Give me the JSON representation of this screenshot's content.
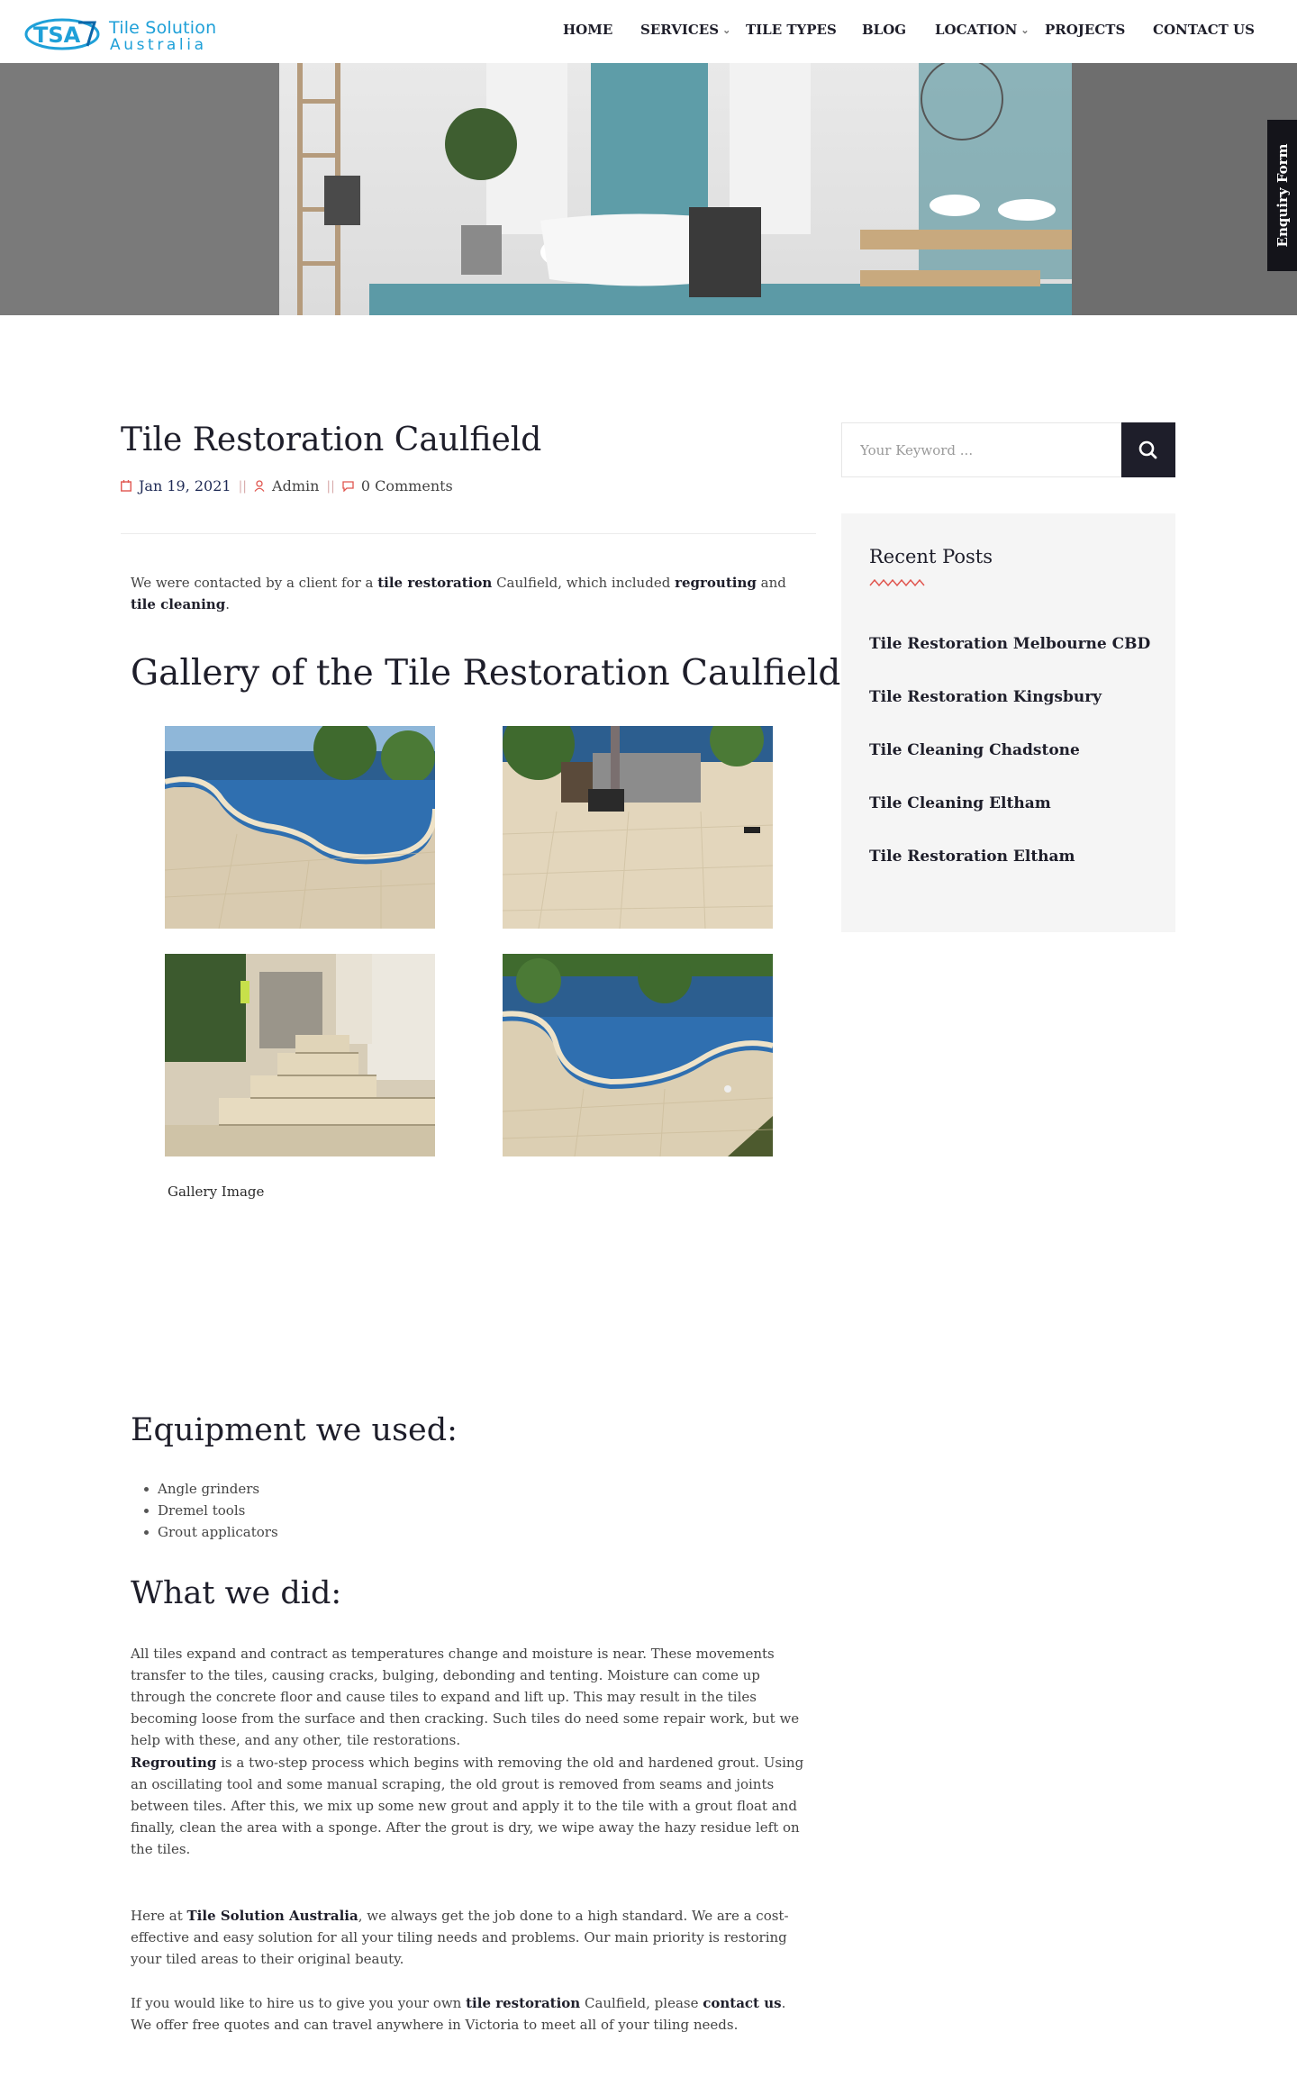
{
  "brand": {
    "name_line1": "Tile Solution",
    "name_line2": "Australia",
    "color": "#1fa0d8"
  },
  "nav": {
    "items": [
      {
        "label": "HOME",
        "has_dropdown": false
      },
      {
        "label": "SERVICES",
        "has_dropdown": true
      },
      {
        "label": "TILE TYPES",
        "has_dropdown": false
      },
      {
        "label": "BLOG",
        "has_dropdown": false
      },
      {
        "label": "LOCATION",
        "has_dropdown": true
      },
      {
        "label": "PROJECTS",
        "has_dropdown": false
      },
      {
        "label": "CONTACT US",
        "has_dropdown": false
      }
    ]
  },
  "enquiry_tab": {
    "label": "Enquiry Form"
  },
  "post": {
    "title": "Tile Restoration Caulfield",
    "date": "Jan 19, 2021",
    "author": "Admin",
    "comments": "0 Comments",
    "intro": {
      "p1": "We were contacted by a client for a ",
      "b1": "tile restoration",
      "p2": " Caulfield, which included ",
      "b2": "regrouting",
      "p3": " and ",
      "b3": "tile cleaning",
      "p4": "."
    },
    "gallery_heading": "Gallery of the Tile Restoration Caulfield",
    "gallery_caption": "Gallery Image",
    "equipment_heading": "Equipment we used:",
    "equipment": [
      "Angle grinders",
      "Dremel tools",
      "Grout applicators"
    ],
    "did_heading": "What we did:",
    "did_p1": "All tiles expand and contract as temperatures change and moisture is near. These movements transfer to the tiles, causing cracks, bulging, debonding and tenting. Moisture can come up through the concrete floor and cause tiles to expand and lift up. This may result in the tiles becoming loose from the surface and then cracking. Such tiles do need some repair work, but we help with these, and any other, tile restorations.",
    "did_p2_bold": "Regrouting",
    "did_p2": " is a two-step process which begins with removing the old and hardened grout. Using an oscillating tool and some manual scraping, the old grout is removed from seams and joints between tiles. After this, we mix up some new grout and apply it to the tile with a grout float and finally, clean the area with a sponge. After the grout is dry, we wipe away the hazy residue left on the tiles.",
    "outro1": {
      "p1": "Here at ",
      "b1": "Tile Solution Australia",
      "p2": ", we always get the job done to a high standard. We are a cost-effective and easy solution for all your tiling needs and problems. Our main priority is restoring your tiled areas to their original beauty."
    },
    "outro2": {
      "p1": "If you would like to hire us to give you your own ",
      "b1": "tile restoration",
      "p2": " Caulfield, please ",
      "b2": "contact us",
      "p3": ". We offer free quotes and can travel anywhere in Victoria to meet all of your tiling needs."
    }
  },
  "sidebar": {
    "search_placeholder": "Your Keyword ...",
    "recent_title": "Recent Posts",
    "recent_posts": [
      "Tile Restoration Melbourne CBD",
      "Tile Restoration Kingsbury",
      "Tile Cleaning Chadstone",
      "Tile Cleaning Eltham",
      "Tile Restoration Eltham"
    ]
  },
  "colors": {
    "dark": "#1e1e2a",
    "accent_red": "#e0564f",
    "link_blue": "#1fa0d8"
  }
}
